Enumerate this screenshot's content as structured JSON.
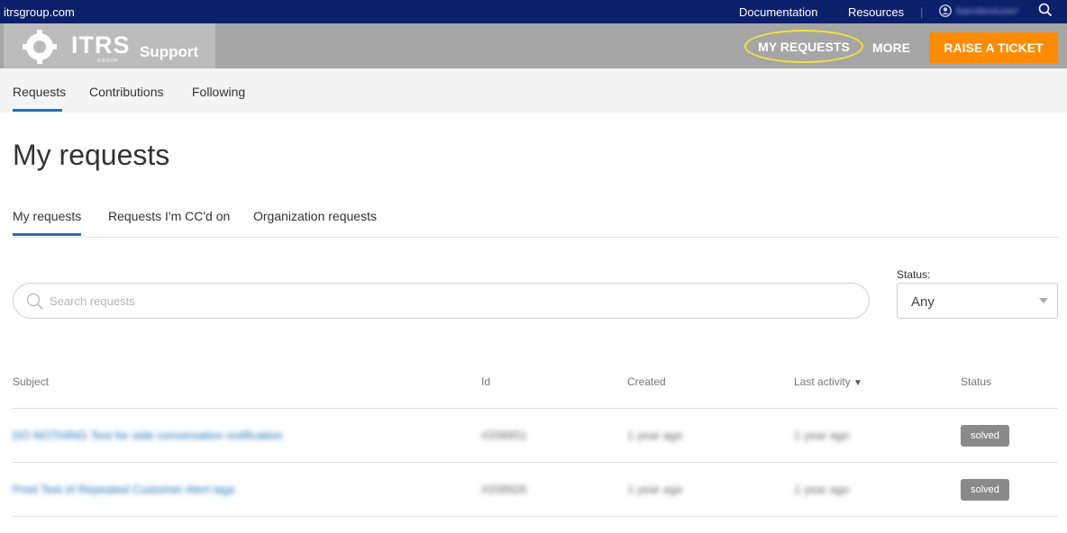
{
  "topbar": {
    "site": "itrsgroup.com",
    "documentation": "Documentation",
    "resources": "Resources",
    "separator": "|",
    "username": "bamitestuser"
  },
  "header": {
    "logo_text": "ITRS",
    "logo_subtext": "GROUP",
    "support": "Support",
    "my_requests": "MY REQUESTS",
    "more": "MORE",
    "raise_ticket": "RAISE A TICKET"
  },
  "subnav": {
    "tabs": [
      "Requests",
      "Contributions",
      "Following"
    ]
  },
  "page": {
    "title": "My requests",
    "request_tabs": [
      "My requests",
      "Requests I'm CC'd on",
      "Organization requests"
    ]
  },
  "search": {
    "placeholder": "Search requests"
  },
  "status_filter": {
    "label": "Status:",
    "value": "Any"
  },
  "table": {
    "headers": {
      "subject": "Subject",
      "id": "Id",
      "created": "Created",
      "last_activity": "Last activity",
      "sort_arrow": "▼",
      "status": "Status"
    },
    "rows": [
      {
        "subject": "DO NOTHING Test for side conversation notification",
        "id": "#208951",
        "created": "1 year ago",
        "last_activity": "1 year ago",
        "status": "solved"
      },
      {
        "subject": "Prod Test of Repeated Customer Alert tags",
        "id": "#208926",
        "created": "1 year ago",
        "last_activity": "1 year ago",
        "status": "solved"
      }
    ]
  },
  "colors": {
    "topbar": "#0b1f6b",
    "header": "#a6a6a6",
    "accent": "#1f73b7",
    "raise_button": "#ff8c00",
    "highlight_ellipse": "#f0e23a",
    "badge": "#8a8a8a"
  }
}
